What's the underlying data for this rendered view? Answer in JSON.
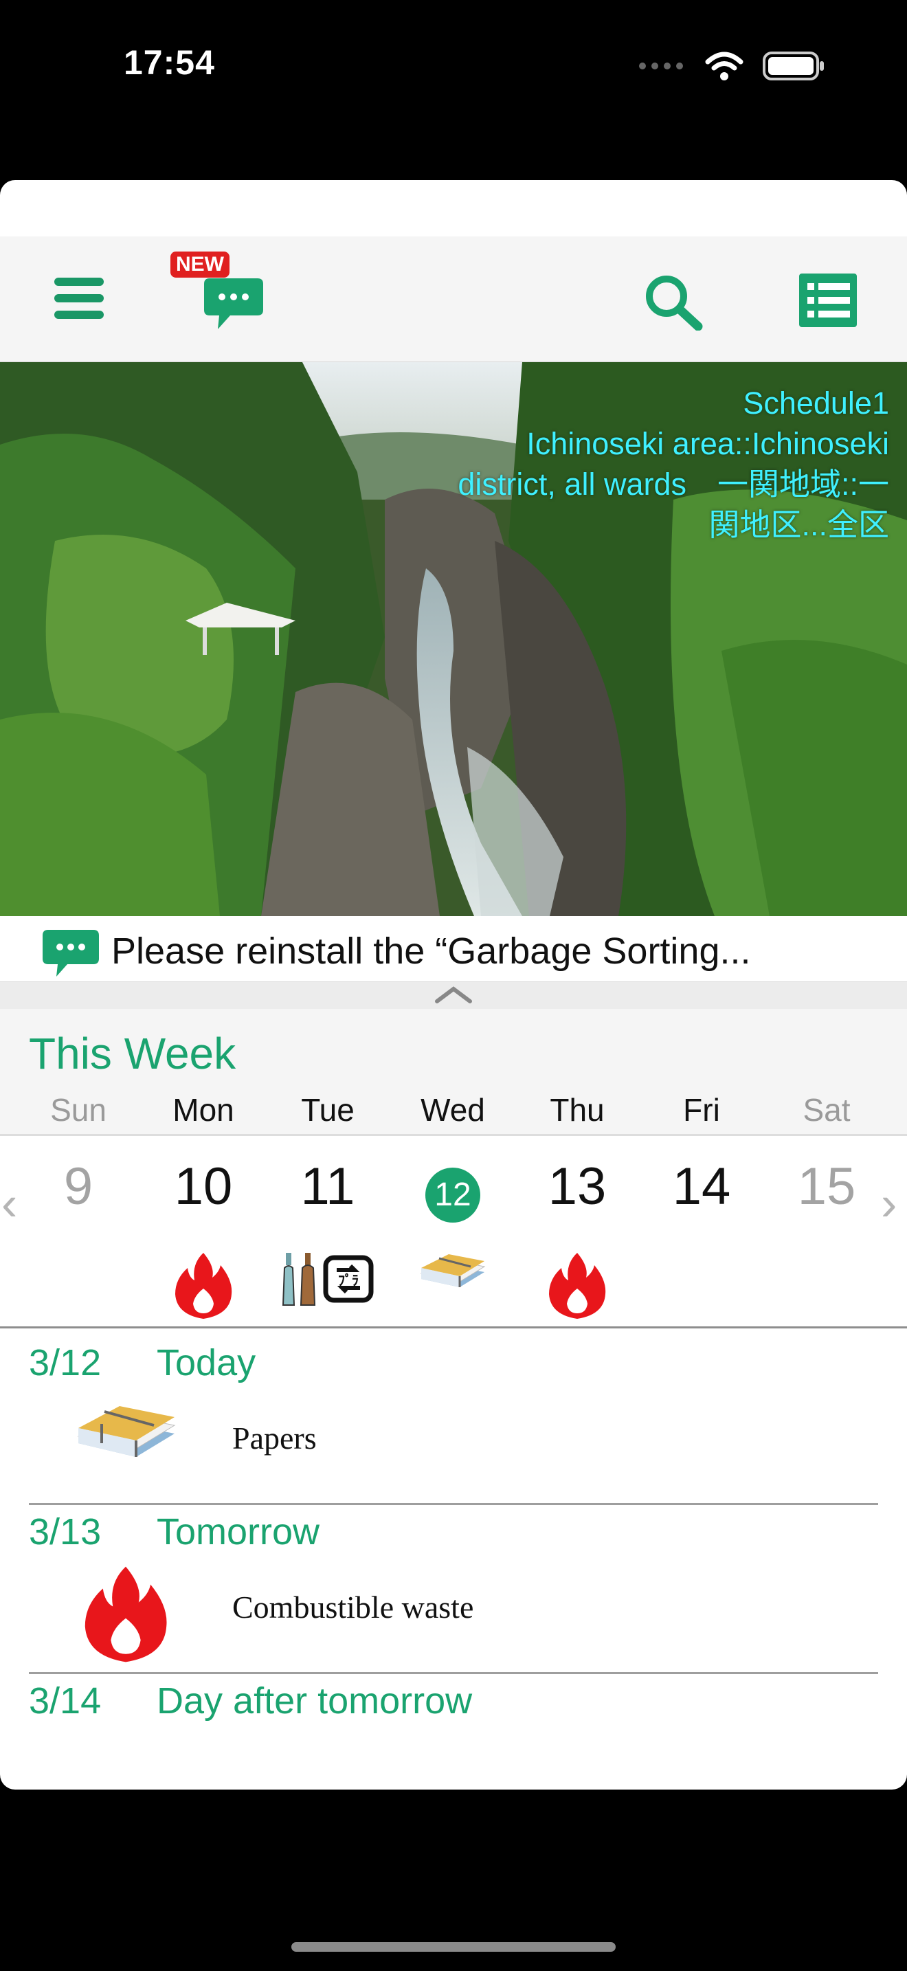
{
  "status_bar": {
    "time": "17:54"
  },
  "toolbar": {
    "new_badge": "NEW",
    "menu_icon": "hamburger-menu-icon",
    "message_icon": "speech-bubble-icon",
    "search_icon": "search-icon",
    "list_icon": "list-icon"
  },
  "hero": {
    "line1": "Schedule1",
    "line2": "Ichinoseki area::Ichinoseki",
    "line3": "district, all wards　一関地域::一",
    "line4": "関地区...全区"
  },
  "news": {
    "text": "Please reinstall the “Garbage Sorting..."
  },
  "week": {
    "title": "This Week",
    "days": [
      {
        "name": "Sun",
        "date": "9"
      },
      {
        "name": "Mon",
        "date": "10"
      },
      {
        "name": "Tue",
        "date": "11"
      },
      {
        "name": "Wed",
        "date": "12"
      },
      {
        "name": "Thu",
        "date": "13"
      },
      {
        "name": "Fri",
        "date": "14"
      },
      {
        "name": "Sat",
        "date": "15"
      }
    ],
    "prev_arrow": "‹",
    "next_arrow": "›"
  },
  "schedule": [
    {
      "date": "3/12",
      "label": "Today",
      "item": "Papers"
    },
    {
      "date": "3/13",
      "label": "Tomorrow",
      "item": "Combustible waste"
    },
    {
      "date": "3/14",
      "label": "Day after tomorrow"
    }
  ],
  "colors": {
    "accent": "#1aa36f",
    "hero_text": "#3ff0ff",
    "flame": "#e8161b"
  }
}
